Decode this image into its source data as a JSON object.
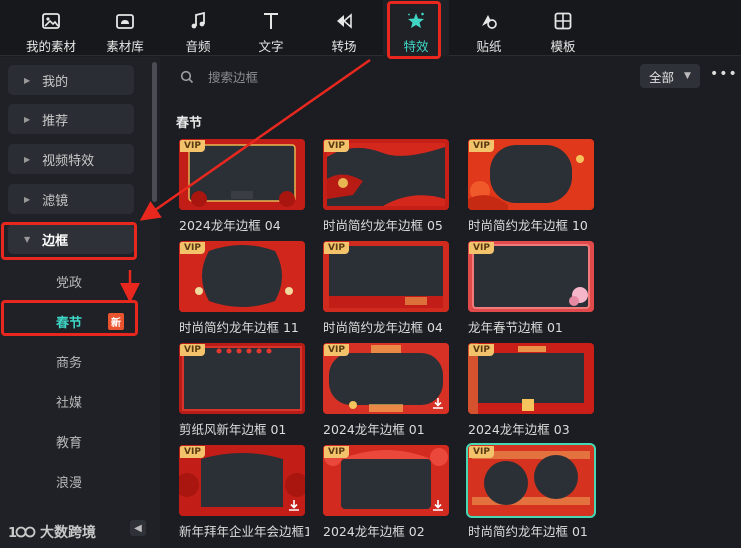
{
  "toolbar": {
    "items": [
      {
        "label": "我的素材",
        "icon": "media-icon"
      },
      {
        "label": "素材库",
        "icon": "cloud-library-icon"
      },
      {
        "label": "音频",
        "icon": "music-note-icon"
      },
      {
        "label": "文字",
        "icon": "text-icon"
      },
      {
        "label": "转场",
        "icon": "transition-icon"
      },
      {
        "label": "特效",
        "icon": "effects-star-icon",
        "active": true
      },
      {
        "label": "贴纸",
        "icon": "sticker-icon"
      },
      {
        "label": "模板",
        "icon": "template-icon"
      }
    ]
  },
  "sidebar": {
    "categories": [
      {
        "label": "我的"
      },
      {
        "label": "推荐"
      },
      {
        "label": "视频特效"
      },
      {
        "label": "滤镜"
      },
      {
        "label": "边框",
        "expanded": true
      }
    ],
    "subitems": [
      {
        "label": "党政"
      },
      {
        "label": "春节",
        "active": true,
        "badge": "新"
      },
      {
        "label": "商务"
      },
      {
        "label": "社媒"
      },
      {
        "label": "教育"
      },
      {
        "label": "浪漫"
      }
    ],
    "logo_text": "大数跨境"
  },
  "main": {
    "search_placeholder": "搜索边框",
    "filter_label": "全部",
    "section_title": "春节",
    "vip_label": "VIP",
    "cards": [
      {
        "title": "2024龙年边框 04"
      },
      {
        "title": "时尚简约龙年边框 05"
      },
      {
        "title": "时尚简约龙年边框 10"
      },
      {
        "title": "时尚简约龙年边框 11"
      },
      {
        "title": "时尚简约龙年边框 04"
      },
      {
        "title": "龙年春节边框 01"
      },
      {
        "title": "剪纸风新年边框 01"
      },
      {
        "title": "2024龙年边框 01"
      },
      {
        "title": "2024龙年边框 03"
      },
      {
        "title": "新年拜年企业年会边框1"
      },
      {
        "title": "2024龙年边框 02"
      },
      {
        "title": "时尚简约龙年边框 01"
      }
    ]
  },
  "colors": {
    "accent": "#3fd6c6",
    "highlight": "#e8281e",
    "vip": "#f2c36b"
  }
}
